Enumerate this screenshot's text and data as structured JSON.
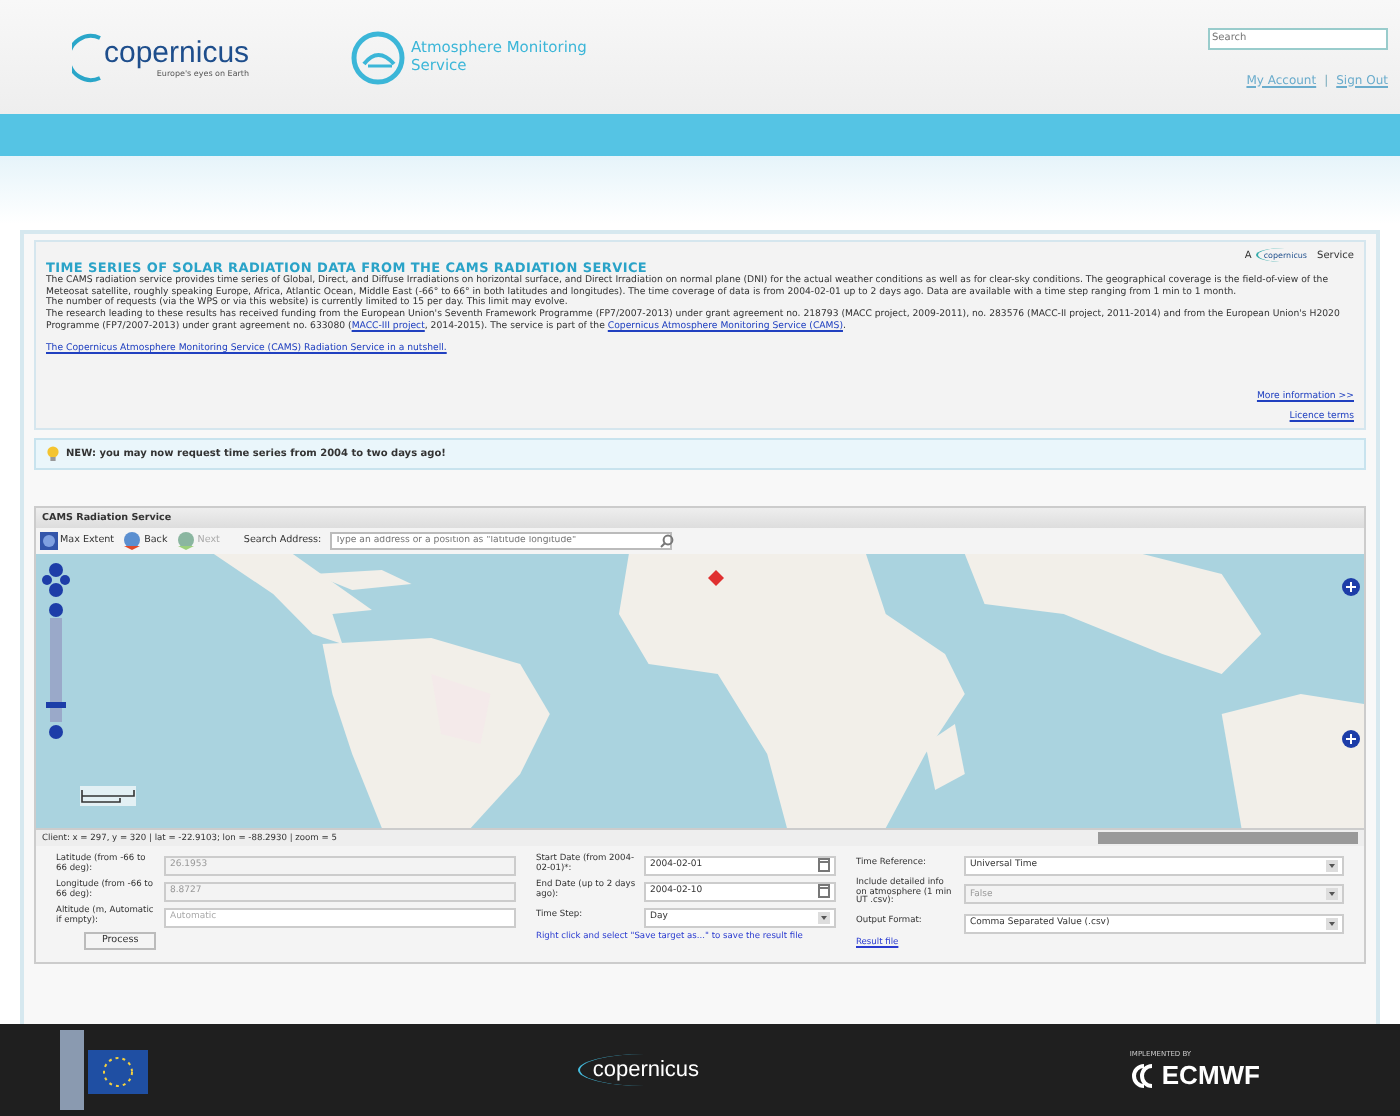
{
  "header": {
    "logo_wordmark": "copernicus",
    "logo_tagline": "Europe's eyes on Earth",
    "service_name": "Atmosphere Monitoring Service",
    "search": {
      "placeholder": "Search"
    },
    "links": [
      "My Account",
      "Sign Out"
    ],
    "link_separator": "|"
  },
  "info": {
    "title": "TIME SERIES OF SOLAR RADIATION DATA FROM THE CAMS RADIATION SERVICE",
    "badge_before": "A",
    "badge_logo": "copernicus",
    "badge_after": "Service",
    "paragraphs": [
      "The CAMS radiation service provides time series of Global, Direct, and Diffuse Irradiations on horizontal surface, and Direct Irradiation on normal plane (DNI) for the actual weather conditions as well as for clear-sky conditions. The geographical coverage is the field-of-view of the Meteosat satellite, roughly speaking Europe, Africa, Atlantic Ocean, Middle East (-66° to 66° in both latitudes and longitudes). The time coverage of data is from 2004-02-01 up to 2 days ago. Data are available with a time step ranging from 1 min to 1 month.",
      "The number of requests (via the WPS or via this website) is currently limited to 15 per day. This limit may evolve."
    ],
    "funding": {
      "text_1": "The research leading to these results has received funding from the European Union's Seventh Framework Programme (FP7/2007-2013) under grant agreement no. 218793 (MACC project, 2009-2011), no. 283576 (MACC-II project, 2011-2014) and from the European Union's H2020 Programme (FP7/2007-2013) under grant agreement no. 633080 (",
      "link_1": "MACC-III project",
      "text_2": ", 2014-2015). The service is part of the ",
      "link_2": "Copernicus Atmosphere Monitoring Service (CAMS)",
      "text_3": "."
    },
    "nutshell_link": "The Copernicus Atmosphere Monitoring Service (CAMS) Radiation Service in a nutshell.",
    "more_link": "More information >>",
    "licence_link": "Licence terms"
  },
  "notice": "NEW: you may now request time series from 2004 to two days ago!",
  "map_panel": {
    "title": "CAMS Radiation Service",
    "tools": [
      {
        "label": "Max Extent",
        "kind": "extent",
        "disabled": false
      },
      {
        "label": "Back",
        "kind": "back",
        "disabled": false
      },
      {
        "label": "Next",
        "kind": "next",
        "disabled": true
      }
    ],
    "search_label": "Search Address:",
    "search_placeholder": "Type an address or a position as \"latitude longitude\"",
    "status": "Client: x = 297, y = 320 | lat = -22.9103; lon = -88.2930 | zoom = 5"
  },
  "form": {
    "columns": [
      [
        {
          "label": "Latitude (from -66 to 66 deg):",
          "value": "26.1953",
          "kind": "input",
          "disabled": true
        },
        {
          "label": "Longitude (from -66 to 66 deg):",
          "value": "8.8727",
          "kind": "input",
          "disabled": true
        },
        {
          "label": "Altitude (m, Automatic if empty):",
          "placeholder": "Automatic",
          "kind": "input",
          "disabled": false
        }
      ],
      [
        {
          "label": "Start Date (from 2004-02-01)*:",
          "value": "2004-02-01",
          "kind": "date",
          "disabled": false
        },
        {
          "label": "End Date (up to 2 days ago):",
          "value": "2004-02-10",
          "kind": "date",
          "disabled": false
        },
        {
          "label": "Time Step:",
          "value": "Day",
          "kind": "select",
          "disabled": false
        }
      ],
      [
        {
          "label": "Time Reference:",
          "value": "Universal Time",
          "kind": "select",
          "disabled": false
        },
        {
          "label": "Include detailed info on atmosphere (1 min UT .csv):",
          "value": "False",
          "kind": "select",
          "disabled": true
        },
        {
          "label": "Output Format:",
          "value": "Comma Separated Value (.csv)",
          "kind": "select",
          "disabled": false
        }
      ]
    ],
    "process_button": "Process",
    "save_hint": "Right click and select \"Save target as...\" to save the result file",
    "result_link": "Result file"
  },
  "footer": {
    "center_logo": "copernicus",
    "right_label": "IMPLEMENTED BY",
    "right_logo": "ECMWF"
  }
}
